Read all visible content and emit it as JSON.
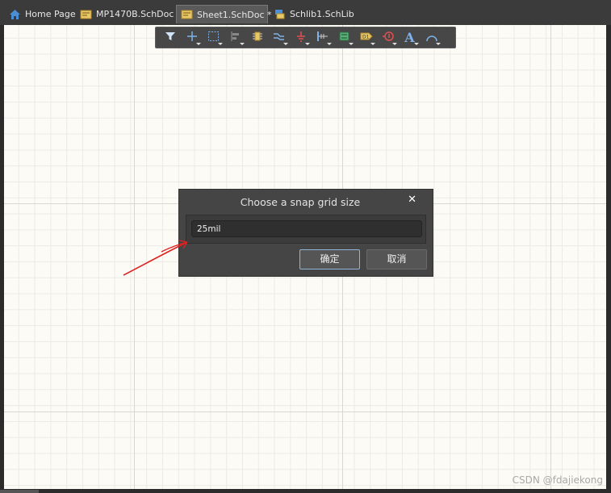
{
  "tabs": [
    {
      "label": "Home Page",
      "icon": "home-icon",
      "active": false
    },
    {
      "label": "MP1470B.SchDoc *",
      "icon": "schdoc-icon",
      "active": false
    },
    {
      "label": "Sheet1.SchDoc *",
      "icon": "schdoc-icon",
      "active": true
    },
    {
      "label": "Schlib1.SchLib",
      "icon": "schlib-icon",
      "active": false
    }
  ],
  "toolbar": {
    "tools": [
      "filter-icon",
      "crosshair-icon",
      "selection-rect-icon",
      "align-icon",
      "part-icon",
      "wire-bus-icon",
      "ground-power-icon",
      "bus-entry-icon",
      "harness-icon",
      "port-icon",
      "directive-icon",
      "text-icon",
      "arc-icon"
    ],
    "text_tool_glyph": "A"
  },
  "dialog": {
    "title": "Choose a snap grid size",
    "value": "25mil",
    "ok_label": "确定",
    "cancel_label": "取消"
  },
  "watermark": "CSDN @fdajiekong",
  "colors": {
    "canvas": "#fdfbf5",
    "accent_blue": "#4a8fd6",
    "annotation_red": "#e02020"
  }
}
